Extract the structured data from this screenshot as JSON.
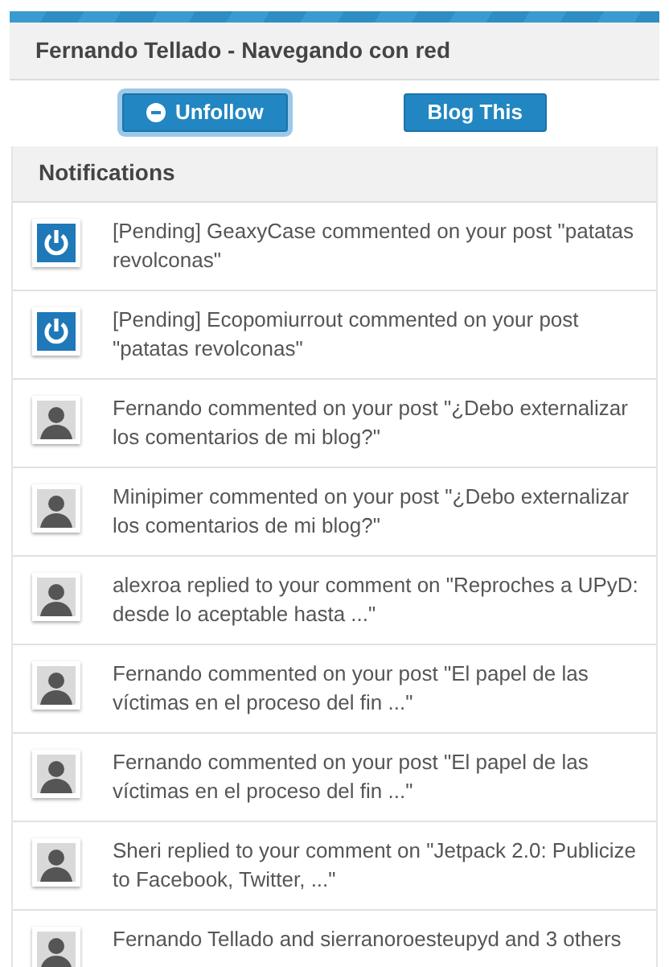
{
  "header": {
    "title": "Fernando Tellado - Navegando con red"
  },
  "buttons": [
    {
      "label": "Unfollow",
      "kind": "unfollow",
      "focused": true
    },
    {
      "label": "Blog This",
      "kind": "plain",
      "focused": false
    }
  ],
  "notifications": {
    "title": "Notifications",
    "items": [
      {
        "kind": "site",
        "text": "[Pending] GeaxyCase commented on your post \"patatas revolconas\""
      },
      {
        "kind": "site",
        "text": "[Pending] Ecopomiurrout commented on your post \"patatas revolconas\""
      },
      {
        "kind": "user",
        "text": "Fernando commented on your post \"¿Debo externalizar los comentarios de mi blog?\""
      },
      {
        "kind": "user",
        "text": "Minipimer commented on your post \"¿Debo externalizar los comentarios de mi blog?\""
      },
      {
        "kind": "user",
        "text": "alexroa replied to your comment on \"Reproches a UPyD: desde lo aceptable hasta ...\""
      },
      {
        "kind": "user",
        "text": "Fernando commented on your post \"El papel de las víctimas en el proceso del fin ...\""
      },
      {
        "kind": "user",
        "text": "Fernando commented on your post \"El papel de las víctimas en el proceso del fin ...\""
      },
      {
        "kind": "user",
        "text": "Sheri replied to your comment on \"Jetpack 2.0: Publicize to Facebook, Twitter, ...\""
      },
      {
        "kind": "user",
        "text": "Fernando Tellado and sierranoroesteupyd and 3 others"
      }
    ]
  }
}
